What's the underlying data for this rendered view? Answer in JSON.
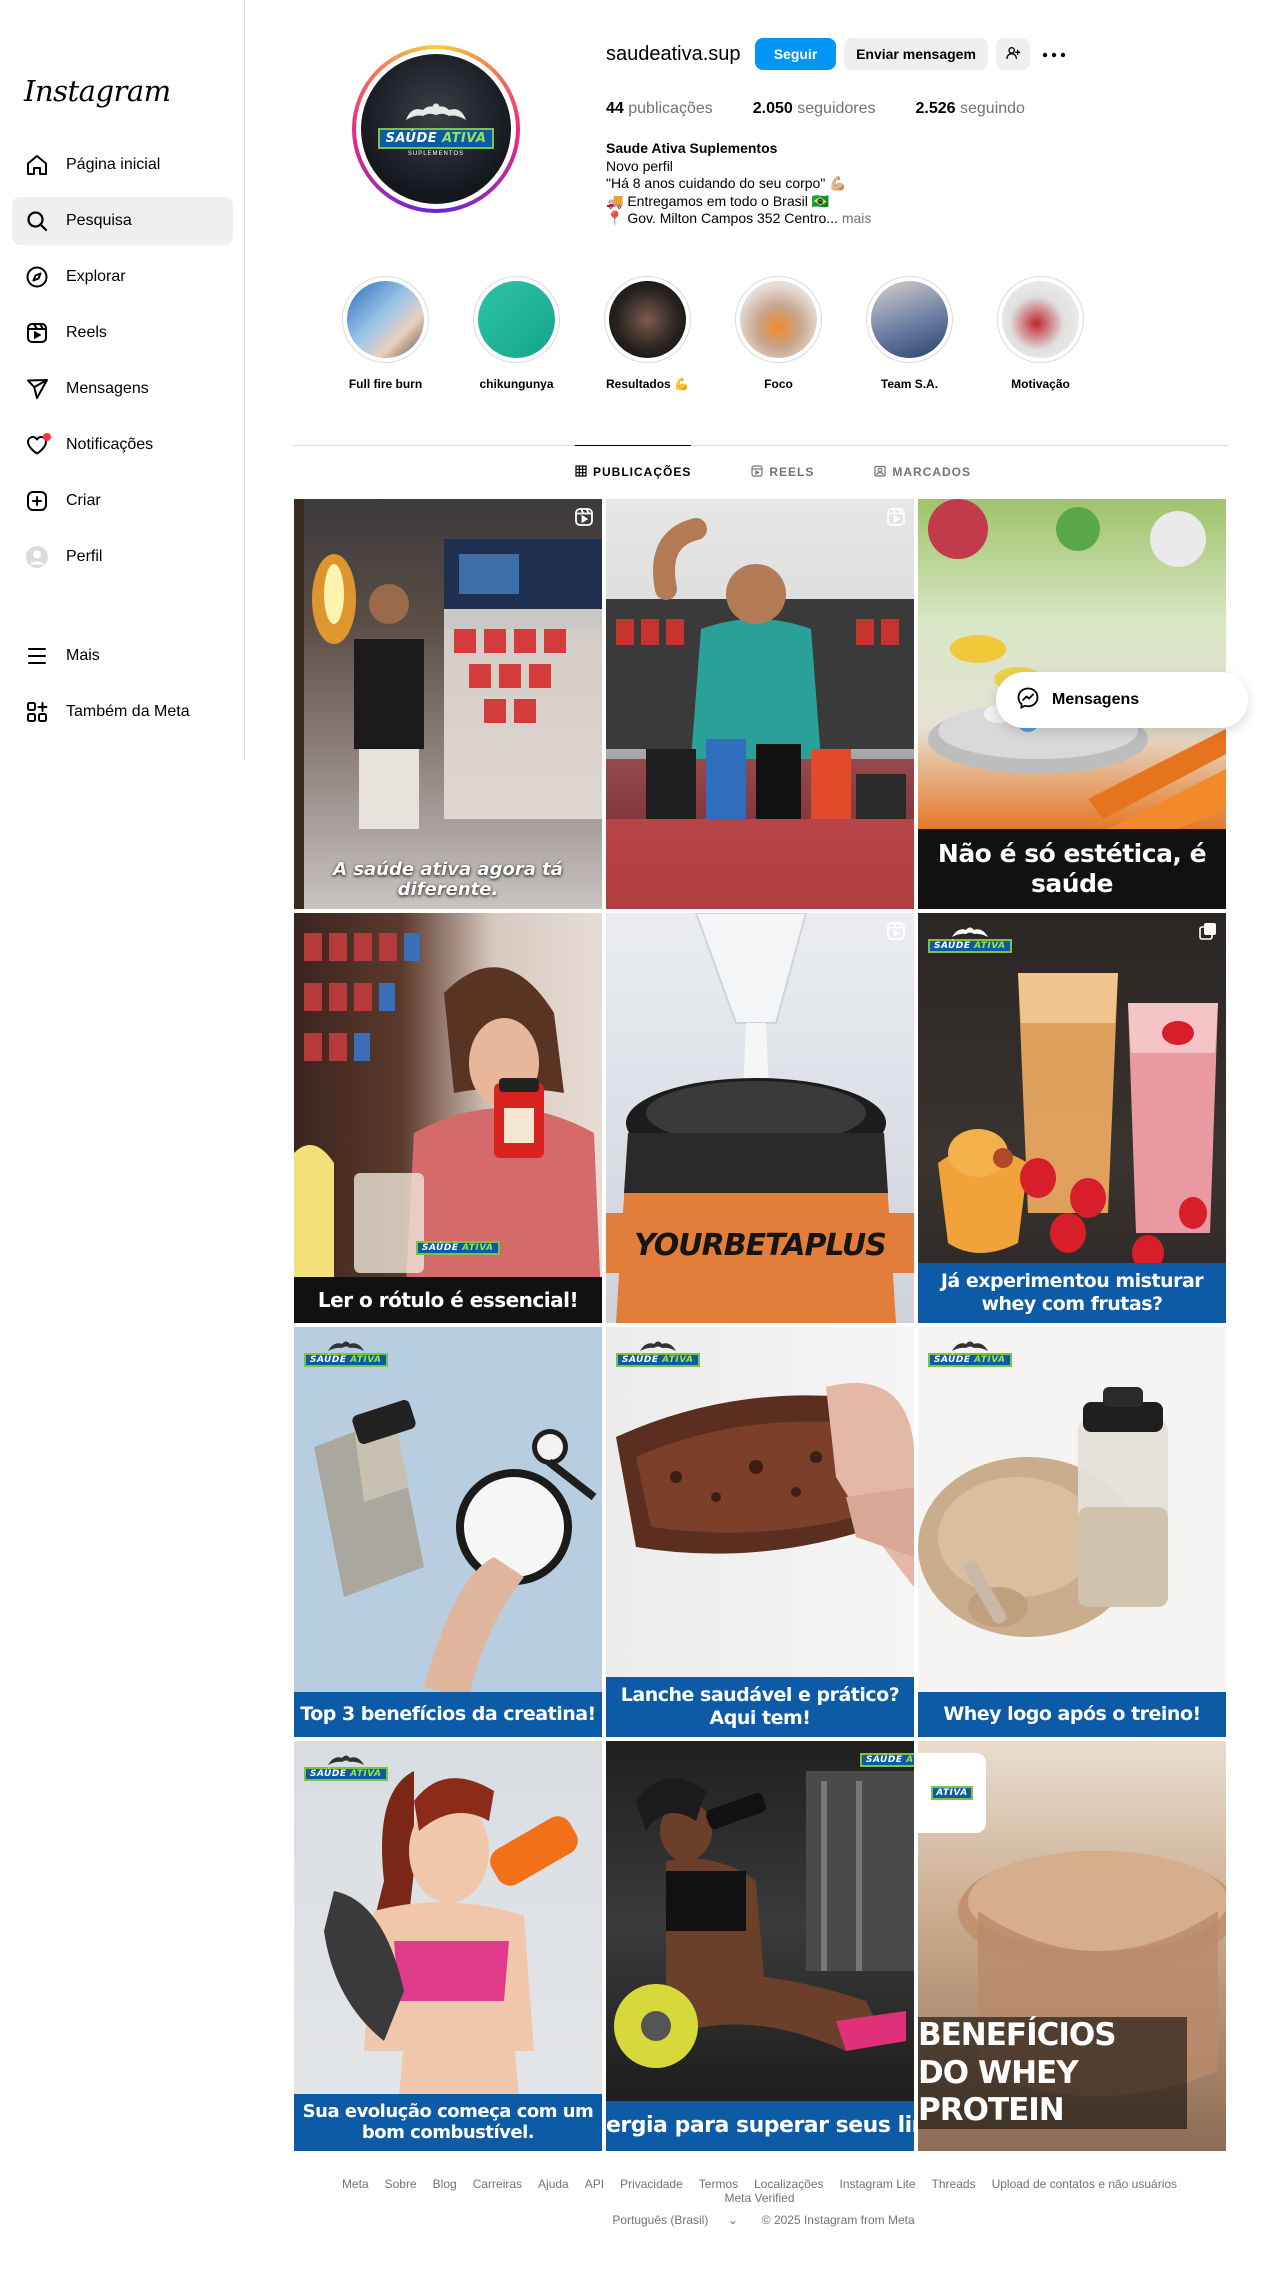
{
  "sidebar": {
    "logo": "Instagram",
    "items": [
      {
        "label": "Página inicial",
        "icon": "home-icon"
      },
      {
        "label": "Pesquisa",
        "icon": "search-icon"
      },
      {
        "label": "Explorar",
        "icon": "compass-icon"
      },
      {
        "label": "Reels",
        "icon": "reels-icon"
      },
      {
        "label": "Mensagens",
        "icon": "send-icon"
      },
      {
        "label": "Notificações",
        "icon": "heart-icon"
      },
      {
        "label": "Criar",
        "icon": "plus-square-icon"
      },
      {
        "label": "Perfil",
        "icon": "avatar-icon"
      }
    ],
    "bottom": [
      {
        "label": "Mais",
        "icon": "menu-icon"
      },
      {
        "label": "Também da Meta",
        "icon": "meta-apps-icon"
      }
    ]
  },
  "profile": {
    "avatar": {
      "muscle_text": "",
      "brand_a": "SAÚDE ",
      "brand_b": "ATIVA",
      "brand_sub": "SUPLEMENTOS"
    },
    "username": "saudeativa.sup",
    "follow_label": "Seguir",
    "message_label": "Enviar mensagem",
    "stats": {
      "posts_count": "44",
      "posts_label": " publicações",
      "followers_count": "2.050",
      "followers_label": " seguidores",
      "following_count": "2.526",
      "following_label": " seguindo"
    },
    "bio": {
      "name": "Saude Ativa Suplementos",
      "line1": "Novo perfil",
      "line2": "\"Há 8 anos cuidando do seu corpo\" 💪🏼",
      "line3": "🚚 Entregamos em todo o Brasil 🇧🇷",
      "line4": "📍 Gov. Milton Campos 352 Centro...",
      "more": " mais"
    }
  },
  "highlights": [
    {
      "label": "Full fire burn",
      "bg": "linear-gradient(135deg,#2c6fb7,#9ac3e8 45%,#e7d2c0 70%,#6c4a3a)"
    },
    {
      "label": "chikungunya",
      "bg": "linear-gradient(135deg,#2ec4a6,#14a58b)"
    },
    {
      "label": "Resultados 💪",
      "bg": "radial-gradient(circle at 50% 50%,#7a5d4e 0%,#2a2320 55%,#0c0c0c 100%)"
    },
    {
      "label": "Foco",
      "bg": "radial-gradient(circle at 50% 60%,#f08a2e 0%,#c7a48b 35%,#e6ddd6 70%)"
    },
    {
      "label": "Team S.A.",
      "bg": "linear-gradient(160deg,#d8d2cc,#6c7fa4 55%,#2a3f6f)"
    },
    {
      "label": "Motivação",
      "bg": "radial-gradient(circle at 45% 55%,#c0272d 0%,#e0e0e0 45%,#f2f2f2 100%)"
    }
  ],
  "tabs": [
    {
      "label": "PUBLICAÇÕES",
      "icon": "grid-icon"
    },
    {
      "label": "REELS",
      "icon": "reels-icon"
    },
    {
      "label": "MARCADOS",
      "icon": "tagged-icon"
    }
  ],
  "posts": [
    {
      "caption": "A saúde ativa agora tá diferente.",
      "type": "reel",
      "style": "plain"
    },
    {
      "caption": "",
      "type": "reel",
      "style": "none"
    },
    {
      "caption": "Não é só estética, é saúde",
      "type": "none",
      "style": "black"
    },
    {
      "caption": "Ler o rótulo é essencial!",
      "type": "none",
      "style": "black"
    },
    {
      "caption": "YOURBETAPLUS",
      "type": "reel",
      "style": "none"
    },
    {
      "caption": "Já experimentou misturar whey com frutas?",
      "type": "carousel",
      "style": "blue"
    },
    {
      "caption": "Top 3 benefícios da creatina!",
      "type": "none",
      "style": "blue"
    },
    {
      "caption": "Lanche saudável e prático? Aqui tem!",
      "type": "none",
      "style": "blue"
    },
    {
      "caption": "Whey logo após o treino!",
      "type": "none",
      "style": "blue"
    },
    {
      "caption": "Sua evolução começa com um bom combustível.",
      "type": "none",
      "style": "blue"
    },
    {
      "caption": "ergia para superar seus limite",
      "type": "none",
      "style": "blue"
    },
    {
      "caption": "BENEFÍCIOS DO WHEY PROTEIN",
      "type": "none",
      "style": "big"
    }
  ],
  "floating_messages": {
    "label": "Mensagens"
  },
  "footer": {
    "links": [
      "Meta",
      "Sobre",
      "Blog",
      "Carreiras",
      "Ajuda",
      "API",
      "Privacidade",
      "Termos",
      "Localizações",
      "Instagram Lite",
      "Threads",
      "Upload de contatos e não usuários",
      "Meta Verified"
    ],
    "language": "Português (Brasil)",
    "copyright": "© 2025 Instagram from Meta"
  },
  "colors": {
    "accent": "#0095f6",
    "brand_blue": "#0d5aa7",
    "brand_green": "#7ec242",
    "notification": "#ff3040"
  }
}
